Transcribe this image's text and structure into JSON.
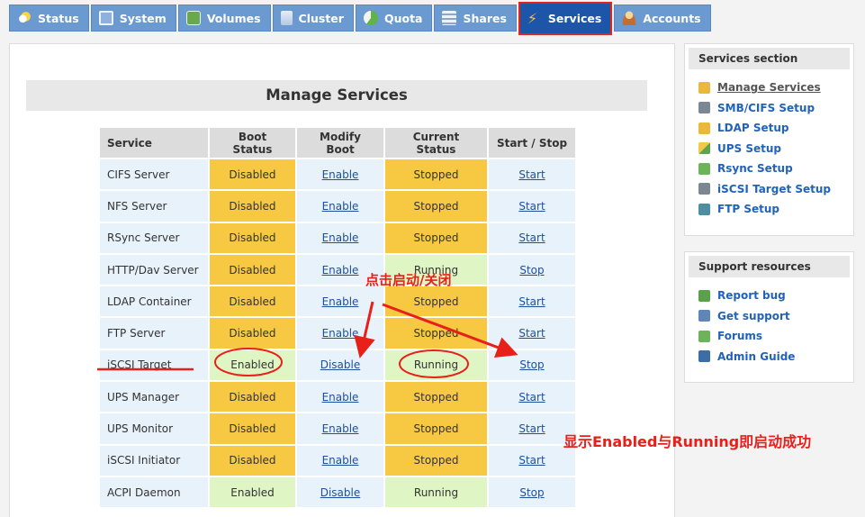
{
  "tabs": [
    {
      "label": "Status",
      "icon": "status-icon",
      "active": false
    },
    {
      "label": "System",
      "icon": "system-icon",
      "active": false
    },
    {
      "label": "Volumes",
      "icon": "volumes-icon",
      "active": false
    },
    {
      "label": "Cluster",
      "icon": "cluster-icon",
      "active": false
    },
    {
      "label": "Quota",
      "icon": "quota-icon",
      "active": false
    },
    {
      "label": "Shares",
      "icon": "shares-icon",
      "active": false
    },
    {
      "label": "Services",
      "icon": "lightning-icon",
      "active": true
    },
    {
      "label": "Accounts",
      "icon": "accounts-icon",
      "active": false
    }
  ],
  "main": {
    "title": "Manage Services",
    "headers": {
      "service": "Service",
      "boot_status": "Boot Status",
      "modify_boot": "Modify Boot",
      "current_status": "Current Status",
      "start_stop": "Start / Stop"
    },
    "rows": [
      {
        "name": "CIFS Server",
        "boot": "Disabled",
        "modify": "Enable",
        "current": "Stopped",
        "action": "Start"
      },
      {
        "name": "NFS Server",
        "boot": "Disabled",
        "modify": "Enable",
        "current": "Stopped",
        "action": "Start"
      },
      {
        "name": "RSync Server",
        "boot": "Disabled",
        "modify": "Enable",
        "current": "Stopped",
        "action": "Start"
      },
      {
        "name": "HTTP/Dav Server",
        "boot": "Disabled",
        "modify": "Enable",
        "current": "Running",
        "action": "Stop"
      },
      {
        "name": "LDAP Container",
        "boot": "Disabled",
        "modify": "Enable",
        "current": "Stopped",
        "action": "Start"
      },
      {
        "name": "FTP Server",
        "boot": "Disabled",
        "modify": "Enable",
        "current": "Stopped",
        "action": "Start"
      },
      {
        "name": "iSCSI Target",
        "boot": "Enabled",
        "modify": "Disable",
        "current": "Running",
        "action": "Stop"
      },
      {
        "name": "UPS Manager",
        "boot": "Disabled",
        "modify": "Enable",
        "current": "Stopped",
        "action": "Start"
      },
      {
        "name": "UPS Monitor",
        "boot": "Disabled",
        "modify": "Enable",
        "current": "Stopped",
        "action": "Start"
      },
      {
        "name": "iSCSI Initiator",
        "boot": "Disabled",
        "modify": "Enable",
        "current": "Stopped",
        "action": "Start"
      },
      {
        "name": "ACPI Daemon",
        "boot": "Enabled",
        "modify": "Disable",
        "current": "Running",
        "action": "Stop"
      }
    ]
  },
  "sidebar": {
    "services_title": "Services section",
    "services_links": [
      {
        "label": "Manage Services",
        "icon": "manage-services-icon"
      },
      {
        "label": "SMB/CIFS Setup",
        "icon": "smb-cifs-icon"
      },
      {
        "label": "LDAP Setup",
        "icon": "ldap-icon"
      },
      {
        "label": "UPS Setup",
        "icon": "ups-icon"
      },
      {
        "label": "Rsync Setup",
        "icon": "rsync-icon"
      },
      {
        "label": "iSCSI Target Setup",
        "icon": "iscsi-icon"
      },
      {
        "label": "FTP Setup",
        "icon": "ftp-icon"
      }
    ],
    "support_title": "Support resources",
    "support_links": [
      {
        "label": "Report bug",
        "icon": "bug-icon"
      },
      {
        "label": "Get support",
        "icon": "support-icon"
      },
      {
        "label": "Forums",
        "icon": "forums-icon"
      },
      {
        "label": "Admin Guide",
        "icon": "guide-icon"
      }
    ]
  },
  "annotations": {
    "click_hint": "点击启动/关闭",
    "success_hint": "显示Enabled与Running即启动成功",
    "color": "#e8201a"
  }
}
